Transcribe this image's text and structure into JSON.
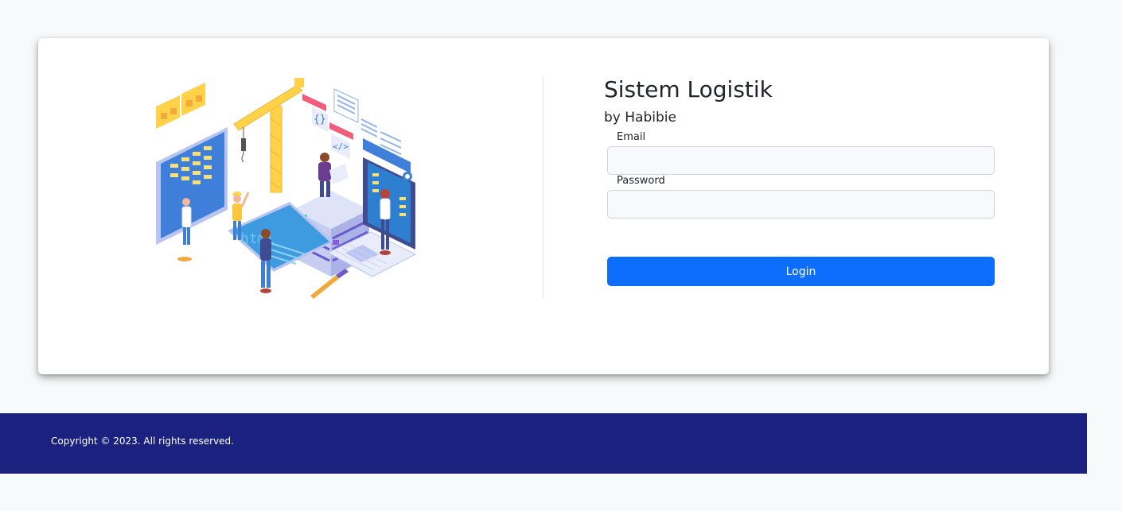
{
  "login": {
    "title": "Sistem Logistik",
    "subtitle": "by Habibie",
    "email_label": "Email",
    "email_value": "",
    "password_label": "Password",
    "password_value": "",
    "submit_label": "Login"
  },
  "footer": {
    "copyright": "Copyright © 2023. All rights reserved."
  },
  "illustration": {
    "icon": "isometric-web-development-illustration",
    "code_text": "html"
  },
  "colors": {
    "primary_button": "#0d6efd",
    "footer_background": "#1b217e",
    "page_background": "#f8f9fa"
  }
}
